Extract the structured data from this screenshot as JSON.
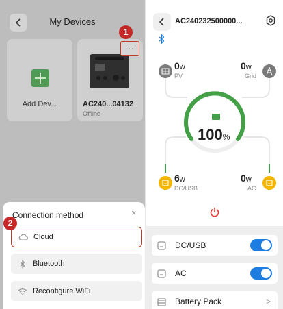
{
  "left": {
    "title": "My Devices",
    "cards": [
      {
        "label": "Add Dev..."
      },
      {
        "label": "AC240...04132",
        "status": "Offline"
      }
    ],
    "more_label": "...",
    "badges": [
      "1",
      "2"
    ],
    "sheet": {
      "title": "Connection method",
      "close": "×",
      "options": [
        {
          "label": "Cloud",
          "icon": "cloud-icon"
        },
        {
          "label": "Bluetooth",
          "icon": "bluetooth-icon"
        },
        {
          "label": "Reconfigure WiFi",
          "icon": "wifi-icon"
        }
      ]
    }
  },
  "right": {
    "title": "AC240232500000...",
    "pv": {
      "value": "0",
      "unit": "w",
      "label": "PV"
    },
    "grid": {
      "value": "0",
      "unit": "w",
      "label": "Grid"
    },
    "soc": {
      "value": "100",
      "unit": "%"
    },
    "dc": {
      "value": "6",
      "unit": "w",
      "label": "DC/USB"
    },
    "ac": {
      "value": "0",
      "unit": "w",
      "label": "AC"
    },
    "rows": [
      {
        "label": "DC/USB",
        "toggle": true
      },
      {
        "label": "AC",
        "toggle": true
      },
      {
        "label": "Battery Pack",
        "chevron": ">"
      }
    ],
    "colors": {
      "accent": "#1e7de0",
      "green": "#43a047",
      "power": "#e53935",
      "warn": "#f4b400"
    }
  }
}
